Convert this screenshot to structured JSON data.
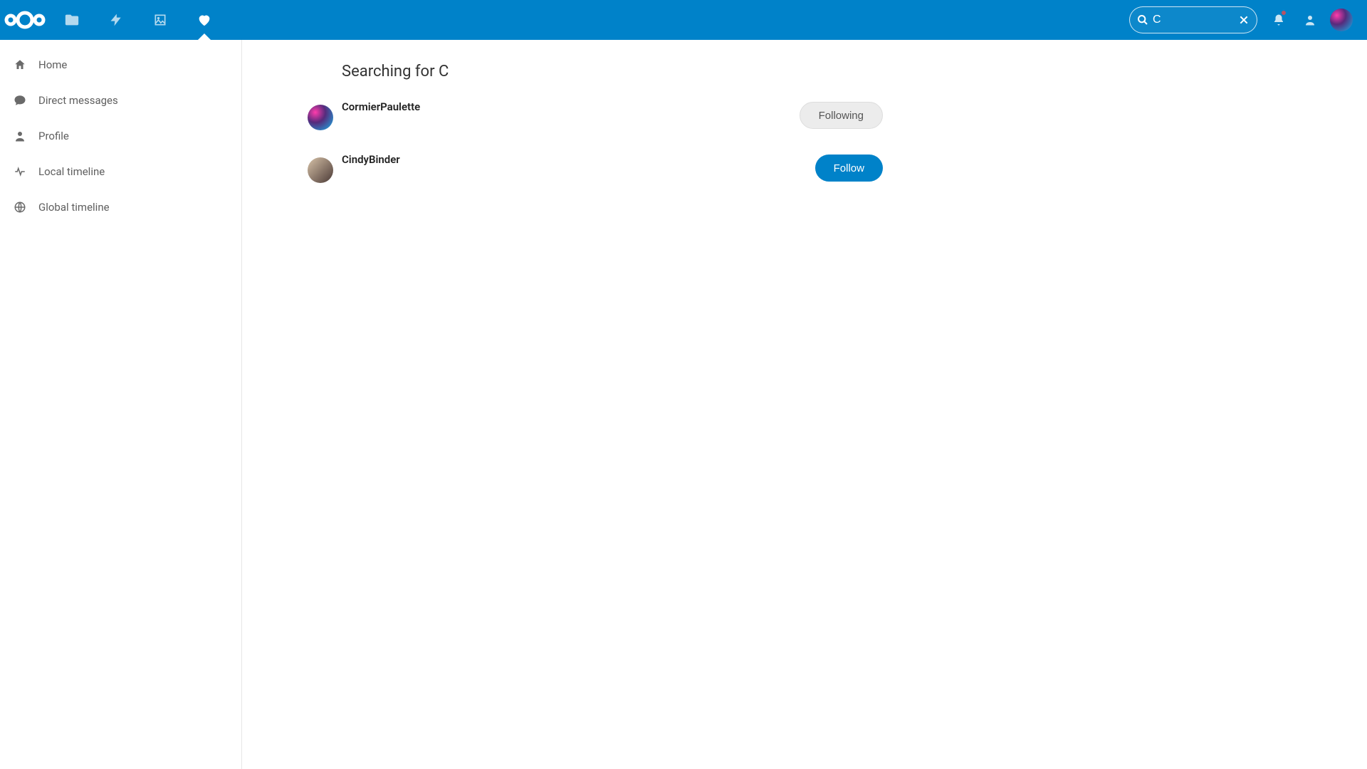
{
  "search": {
    "value": "C"
  },
  "sidebar": {
    "items": [
      {
        "label": "Home"
      },
      {
        "label": "Direct messages"
      },
      {
        "label": "Profile"
      },
      {
        "label": "Local timeline"
      },
      {
        "label": "Global timeline"
      }
    ]
  },
  "main": {
    "heading": "Searching for C",
    "results": [
      {
        "name": "CormierPaulette",
        "button_label": "Following",
        "button_state": "following"
      },
      {
        "name": "CindyBinder",
        "button_label": "Follow",
        "button_state": "follow"
      }
    ]
  },
  "colors": {
    "brand": "#0082c9"
  }
}
